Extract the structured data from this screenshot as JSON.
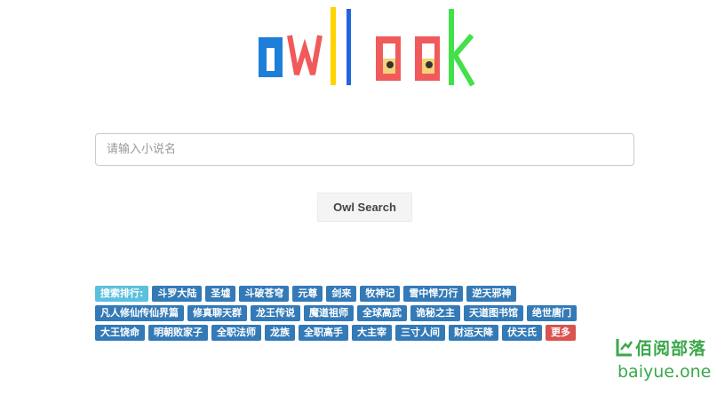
{
  "logo": {
    "text": "owllook"
  },
  "search": {
    "placeholder": "请输入小说名",
    "value": ""
  },
  "search_button": {
    "label": "Owl Search"
  },
  "ranking": {
    "label": "搜索排行:",
    "rows": [
      [
        "斗罗大陆",
        "圣墟",
        "斗破苍穹",
        "元尊",
        "剑来",
        "牧神记",
        "雪中悍刀行",
        "逆天邪神"
      ],
      [
        "凡人修仙传仙界篇",
        "修真聊天群",
        "龙王传说",
        "魔道祖师",
        "全球高武",
        "诡秘之主",
        "天道图书馆",
        "绝世唐门"
      ],
      [
        "大王饶命",
        "明朝败家子",
        "全职法师",
        "龙族",
        "全职高手",
        "大主宰",
        "三寸人间",
        "财运天降",
        "伏天氏"
      ]
    ],
    "more": "更多"
  },
  "watermark": {
    "cn": "佰阅部落",
    "en": "baiyue.one"
  }
}
